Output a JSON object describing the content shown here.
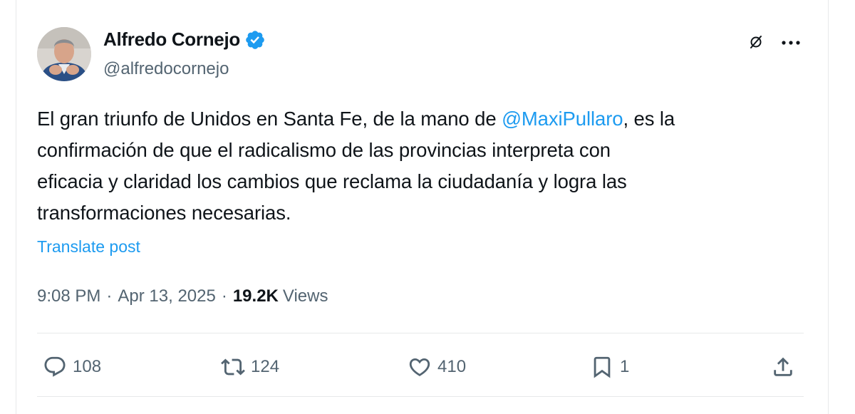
{
  "author": {
    "display_name": "Alfredo Cornejo",
    "handle": "@alfredocornejo",
    "verified": true
  },
  "tweet": {
    "lines": [
      {
        "before": "El gran triunfo de Unidos en Santa Fe, de la mano de ",
        "mention": "@MaxiPullaro",
        "after": ", es la"
      },
      {
        "text": "confirmación de que el radicalismo de las provincias interpreta con"
      },
      {
        "text": "eficacia y claridad los cambios que reclama la ciudadanía y logra las"
      },
      {
        "text": "transformaciones necesarias."
      }
    ],
    "translate_label": "Translate post"
  },
  "meta": {
    "time": "9:08 PM",
    "separator": "·",
    "date": "Apr 13, 2025",
    "views_count": "19.2K",
    "views_label": "Views"
  },
  "actions": {
    "replies": "108",
    "reposts": "124",
    "likes": "410",
    "bookmarks": "1"
  },
  "colors": {
    "accent": "#1d9bf0",
    "secondary_text": "#536471",
    "primary_text": "#0f1419",
    "divider": "#e7e9ea"
  },
  "icons": [
    "verified-badge-icon",
    "grok-icon",
    "more-icon",
    "reply-icon",
    "repost-icon",
    "like-icon",
    "bookmark-icon",
    "share-icon"
  ]
}
